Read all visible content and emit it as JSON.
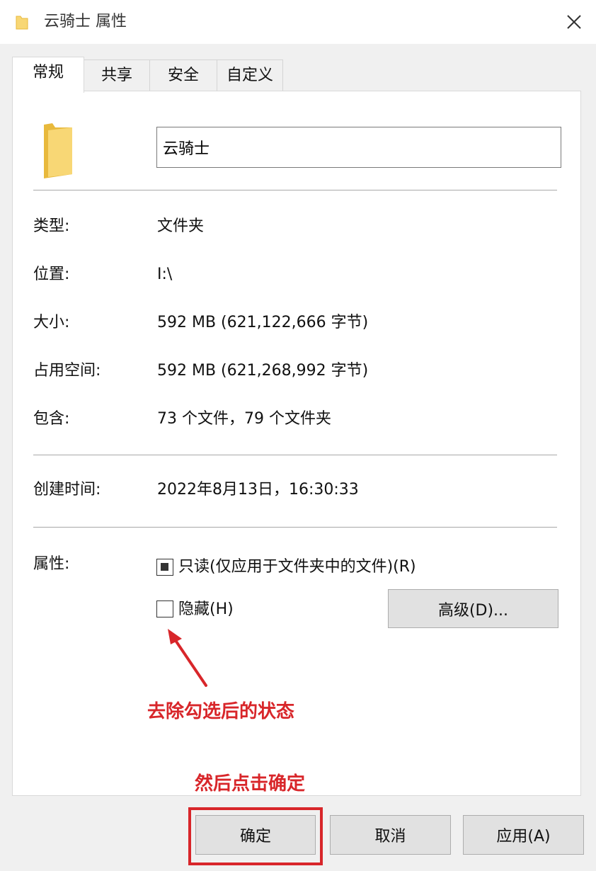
{
  "window": {
    "title": "云骑士 属性",
    "close_icon": "close-icon"
  },
  "tabs": [
    {
      "label": "常规",
      "active": true
    },
    {
      "label": "共享",
      "active": false
    },
    {
      "label": "安全",
      "active": false
    },
    {
      "label": "自定义",
      "active": false
    }
  ],
  "general": {
    "name_value": "云骑士",
    "rows": [
      {
        "label": "类型:",
        "value": "文件夹"
      },
      {
        "label": "位置:",
        "value": "I:\\"
      },
      {
        "label": "大小:",
        "value": "592 MB (621,122,666 字节)"
      },
      {
        "label": "占用空间:",
        "value": "592 MB (621,268,992 字节)"
      },
      {
        "label": "包含:",
        "value": "73 个文件，79 个文件夹"
      }
    ],
    "created": {
      "label": "创建时间:",
      "value": "2022年8月13日，16:30:33"
    },
    "attributes": {
      "label": "属性:",
      "readonly_label": "只读(仅应用于文件夹中的文件)(R)",
      "readonly_state": "indeterminate",
      "hidden_label": "隐藏(H)",
      "hidden_checked": false,
      "advanced_button": "高级(D)..."
    }
  },
  "annotations": {
    "arrow_note": "去除勾选后的状态",
    "ok_note": "然后点击确定",
    "color": "#d8262a"
  },
  "footer": {
    "ok": "确定",
    "cancel": "取消",
    "apply": "应用(A)"
  },
  "colors": {
    "folder": "#f8d775",
    "folder_dark": "#e8b93c",
    "panel_bg": "#ffffff",
    "window_bg": "#f0f0f0"
  }
}
